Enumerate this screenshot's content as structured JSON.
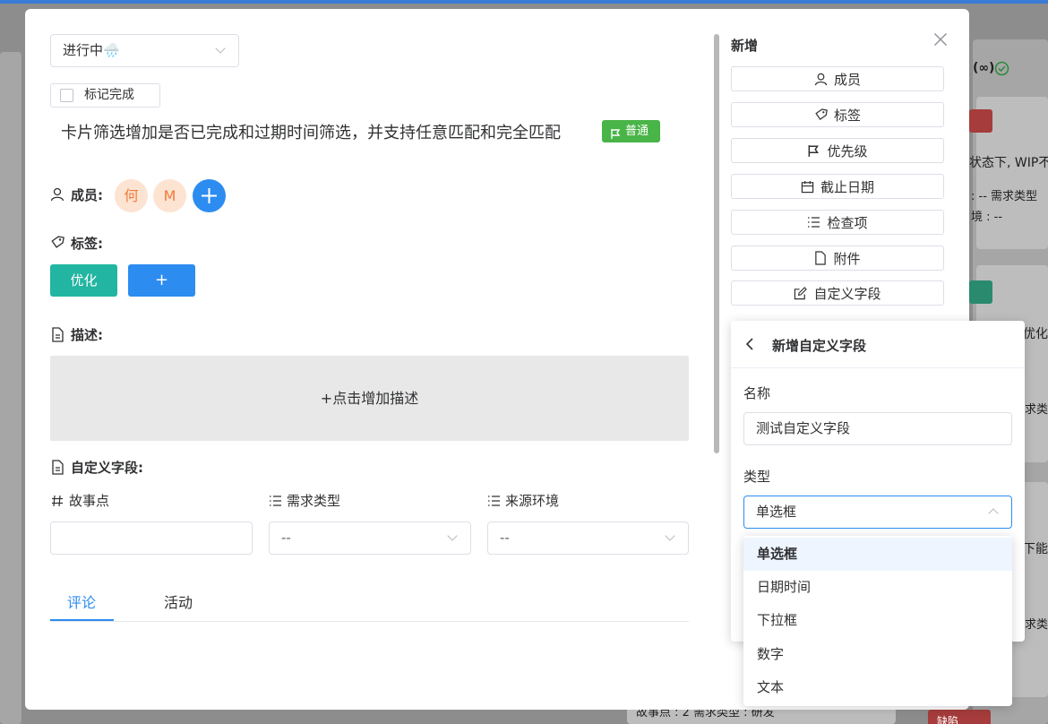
{
  "background": {
    "texts": [
      "(∞)",
      "状态下, WIP不",
      ": --   需求类型",
      "境 : --",
      "优化",
      "求类型",
      "下能编",
      "求类型",
      "故事点 : 2   需求类型 : 研发"
    ],
    "tags": [
      "缺陷"
    ]
  },
  "card": {
    "status": "进行中🌧️",
    "mark_done_label": "标记完成",
    "title": "卡片筛选增加是否已完成和过期时间筛选，并支持任意匹配和完全匹配",
    "priority_tag": "普通",
    "members_label": "成员:",
    "members": [
      "何",
      "M"
    ],
    "tags_label": "标签:",
    "tags": [
      "优化"
    ],
    "add_tag_symbol": "+",
    "description_label": "描述:",
    "description_placeholder": "+点击增加描述",
    "custom_fields_label": "自定义字段:",
    "custom_fields": [
      {
        "label": "故事点",
        "value": ""
      },
      {
        "label": "需求类型",
        "value": "--"
      },
      {
        "label": "来源环境",
        "value": "--"
      }
    ],
    "tabs": [
      "评论",
      "活动"
    ],
    "active_tab": "评论"
  },
  "sidebar": {
    "title": "新增",
    "buttons": [
      "成员",
      "标签",
      "优先级",
      "截止日期",
      "检查项",
      "附件",
      "自定义字段"
    ]
  },
  "popover": {
    "title": "新增自定义字段",
    "name_label": "名称",
    "name_value": "测试自定义字段",
    "type_label": "类型",
    "type_value": "单选框",
    "options": [
      "单选框",
      "日期时间",
      "下拉框",
      "数字",
      "文本"
    ],
    "selected_option": "单选框"
  },
  "colors": {
    "accent": "#2d8cf0",
    "priority_green": "#49b448",
    "tag_teal": "#22b5a1",
    "avatar_bg": "#fde3d2",
    "avatar_text": "#f07c3a"
  }
}
